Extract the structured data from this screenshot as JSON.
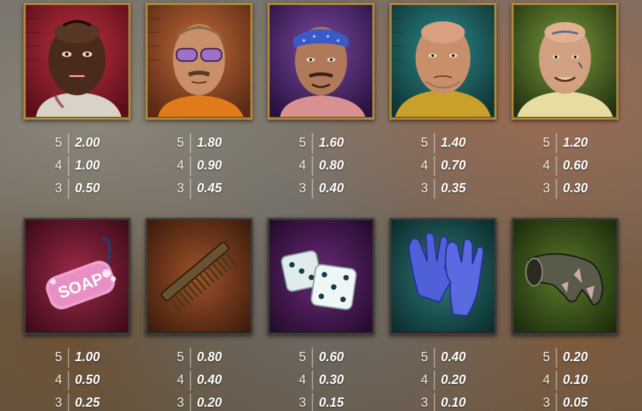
{
  "symbols_top": [
    {
      "name": "Tattooed inmate",
      "icon": "inmate-gang-tattoo-icon",
      "bg": "#8a1c2c",
      "pays": [
        {
          "count": "5",
          "value": "2.00"
        },
        {
          "count": "4",
          "value": "1.00"
        },
        {
          "count": "3",
          "value": "0.50"
        }
      ]
    },
    {
      "name": "Sunglasses inmate",
      "icon": "inmate-sunglasses-icon",
      "bg": "#8a4a24",
      "pays": [
        {
          "count": "5",
          "value": "1.80"
        },
        {
          "count": "4",
          "value": "0.90"
        },
        {
          "count": "3",
          "value": "0.45"
        }
      ]
    },
    {
      "name": "Bandana inmate",
      "icon": "inmate-bandana-icon",
      "bg": "#4a2a6a",
      "pays": [
        {
          "count": "5",
          "value": "1.60"
        },
        {
          "count": "4",
          "value": "0.80"
        },
        {
          "count": "3",
          "value": "0.40"
        }
      ]
    },
    {
      "name": "Bald inmate",
      "icon": "inmate-bald-icon",
      "bg": "#1f5a5a",
      "pays": [
        {
          "count": "5",
          "value": "1.40"
        },
        {
          "count": "4",
          "value": "0.70"
        },
        {
          "count": "3",
          "value": "0.35"
        }
      ]
    },
    {
      "name": "Lucky inmate",
      "icon": "inmate-lucky-tattoo-icon",
      "bg": "#4a6a2a",
      "pays": [
        {
          "count": "5",
          "value": "1.20"
        },
        {
          "count": "4",
          "value": "0.60"
        },
        {
          "count": "3",
          "value": "0.30"
        }
      ]
    }
  ],
  "symbols_bottom": [
    {
      "name": "Soap",
      "icon": "soap-icon",
      "bg": "#7a1c34",
      "label": "SOAP",
      "pays": [
        {
          "count": "5",
          "value": "1.00"
        },
        {
          "count": "4",
          "value": "0.50"
        },
        {
          "count": "3",
          "value": "0.25"
        }
      ]
    },
    {
      "name": "Comb",
      "icon": "comb-icon",
      "bg": "#6a3418",
      "pays": [
        {
          "count": "5",
          "value": "0.80"
        },
        {
          "count": "4",
          "value": "0.40"
        },
        {
          "count": "3",
          "value": "0.20"
        }
      ]
    },
    {
      "name": "Dice",
      "icon": "dice-icon",
      "bg": "#4a2058",
      "pays": [
        {
          "count": "5",
          "value": "0.60"
        },
        {
          "count": "4",
          "value": "0.30"
        },
        {
          "count": "3",
          "value": "0.15"
        }
      ]
    },
    {
      "name": "Gloves",
      "icon": "gloves-icon",
      "bg": "#1f5a5a",
      "pays": [
        {
          "count": "5",
          "value": "0.40"
        },
        {
          "count": "4",
          "value": "0.20"
        },
        {
          "count": "3",
          "value": "0.10"
        }
      ]
    },
    {
      "name": "Sock",
      "icon": "sock-icon",
      "bg": "#3e5a22",
      "pays": [
        {
          "count": "5",
          "value": "0.20"
        },
        {
          "count": "4",
          "value": "0.10"
        },
        {
          "count": "3",
          "value": "0.05"
        }
      ]
    }
  ],
  "colors": {
    "tile_border_gold": "#b08a3a",
    "tile_border_dark": "#3e3a36",
    "text": "#ffffff"
  }
}
